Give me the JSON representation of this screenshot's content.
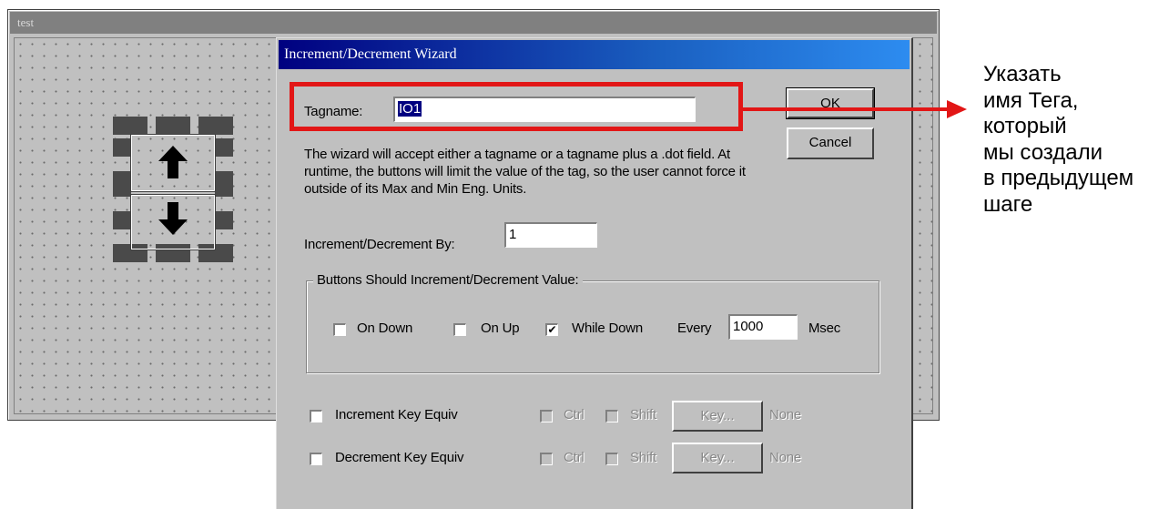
{
  "background_window": {
    "title": "test"
  },
  "dialog": {
    "title": "Increment/Decrement Wizard",
    "tagname_label": "Tagname:",
    "tagname_value": "IO1",
    "ok_label": "OK",
    "cancel_label": "Cancel",
    "description": "The wizard will accept either a tagname or a tagname plus a .dot field.  At runtime, the buttons will limit the value of the tag, so the user cannot force it outside of its Max and Min Eng. Units.",
    "increment_by_label": "Increment/Decrement By:",
    "increment_by_value": "1",
    "group_title": "Buttons Should Increment/Decrement Value:",
    "options": {
      "on_down": {
        "label": "On Down",
        "checked": false
      },
      "on_up": {
        "label": "On Up",
        "checked": false
      },
      "while_down": {
        "label": "While Down",
        "checked": true
      },
      "every_label": "Every",
      "every_value": "1000",
      "msec_label": "Msec"
    },
    "increment_key": {
      "label": "Increment Key Equiv",
      "ctrl": "Ctrl",
      "shift": "Shift",
      "key_button": "Key...",
      "value": "None"
    },
    "decrement_key": {
      "label": "Decrement Key Equiv",
      "ctrl": "Ctrl",
      "shift": "Shift",
      "key_button": "Key...",
      "value": "None"
    }
  },
  "annotation": {
    "text": "Указать\nимя Тега,\nкоторый\nмы создали\nв предыдущем\nшаге",
    "color": "#e21616"
  }
}
